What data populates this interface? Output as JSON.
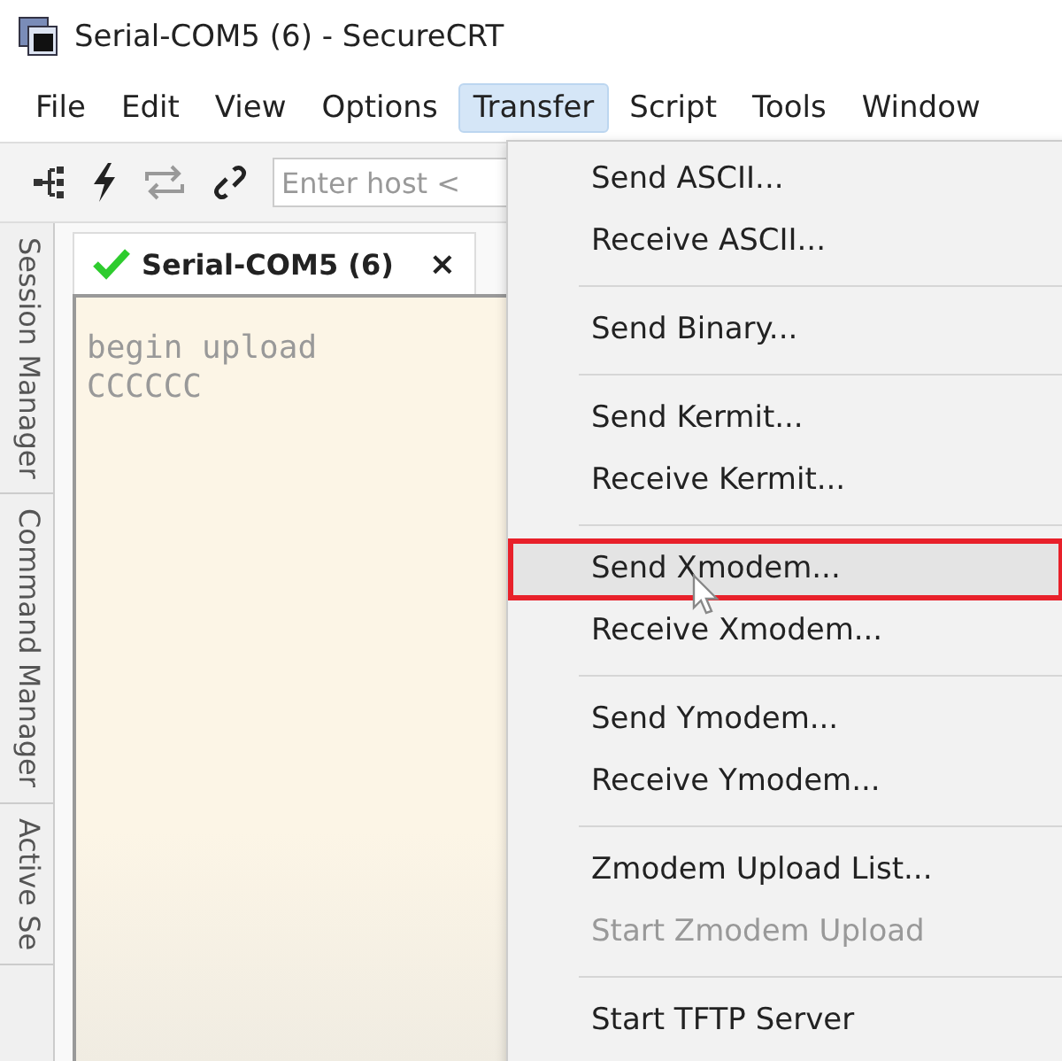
{
  "window": {
    "title": "Serial-COM5 (6) - SecureCRT"
  },
  "menu_bar": [
    {
      "label": "File",
      "selected": false
    },
    {
      "label": "Edit",
      "selected": false
    },
    {
      "label": "View",
      "selected": false
    },
    {
      "label": "Options",
      "selected": false
    },
    {
      "label": "Transfer",
      "selected": true
    },
    {
      "label": "Script",
      "selected": false
    },
    {
      "label": "Tools",
      "selected": false
    },
    {
      "label": "Window",
      "selected": false
    }
  ],
  "toolbar": {
    "host_field": {
      "placeholder": "Enter host <"
    }
  },
  "side_tabs": [
    "Session Manager",
    "Command Manager",
    "Active Se"
  ],
  "session_tab": {
    "label": "Serial-COM5 (6)",
    "connected": true,
    "close": "×"
  },
  "terminal": {
    "lines": [
      "begin upload",
      "CCCCCC"
    ]
  },
  "transfer_menu": [
    [
      {
        "label": "Send ASCII...",
        "selected": false,
        "disabled": false
      },
      {
        "label": "Receive ASCII...",
        "selected": false,
        "disabled": false
      }
    ],
    [
      {
        "label": "Send Binary...",
        "selected": false,
        "disabled": false
      }
    ],
    [
      {
        "label": "Send Kermit...",
        "selected": false,
        "disabled": false
      },
      {
        "label": "Receive Kermit...",
        "selected": false,
        "disabled": false
      }
    ],
    [
      {
        "label": "Send Xmodem...",
        "selected": true,
        "disabled": false
      },
      {
        "label": "Receive Xmodem...",
        "selected": false,
        "disabled": false
      }
    ],
    [
      {
        "label": "Send Ymodem...",
        "selected": false,
        "disabled": false
      },
      {
        "label": "Receive Ymodem...",
        "selected": false,
        "disabled": false
      }
    ],
    [
      {
        "label": "Zmodem Upload List...",
        "selected": false,
        "disabled": false
      },
      {
        "label": "Start Zmodem Upload",
        "selected": false,
        "disabled": true
      }
    ],
    [
      {
        "label": "Start TFTP Server",
        "selected": false,
        "disabled": false
      }
    ]
  ]
}
